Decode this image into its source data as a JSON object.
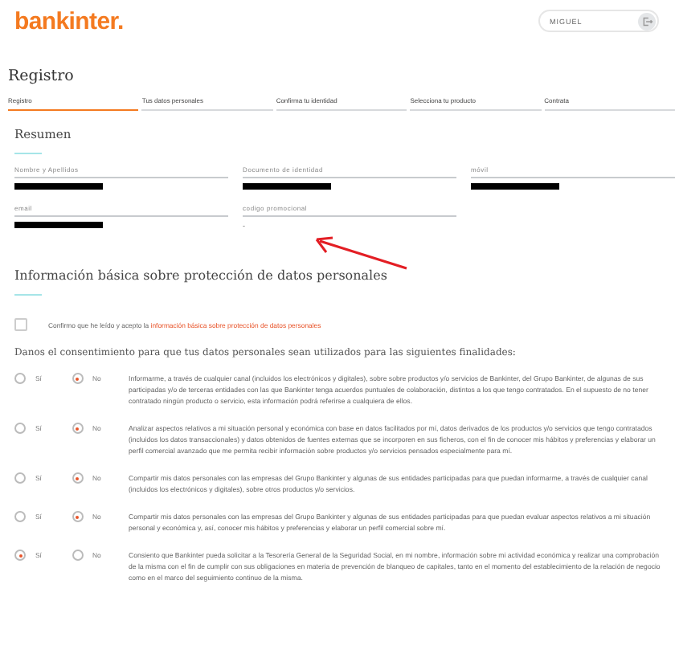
{
  "header": {
    "logo": "bankinter.",
    "user": "MIGUEL"
  },
  "page_title": "Registro",
  "steps": [
    {
      "label": "Registro",
      "selected": true
    },
    {
      "label": "Tus datos personales",
      "selected": false
    },
    {
      "label": "Confirma tu identidad",
      "selected": false
    },
    {
      "label": "Selecciona tu producto",
      "selected": false
    },
    {
      "label": "Contrata",
      "selected": false
    }
  ],
  "summary": {
    "title": "Resumen",
    "fields": [
      {
        "label": "Nombre y Apellidos",
        "redacted": true
      },
      {
        "label": "Documento de identidad",
        "redacted": true
      },
      {
        "label": "móvil",
        "redacted": true
      },
      {
        "label": "email",
        "redacted": true
      },
      {
        "label": "codigo promocional",
        "redacted": false,
        "value": "-"
      }
    ]
  },
  "privacy": {
    "title": "Información básica sobre protección de datos personales",
    "confirm": {
      "checked": false,
      "text": "Confirmo que he leído y acepto la ",
      "link": "información básica sobre protección de datos personales"
    },
    "consent_heading": "Danos el consentimiento para que tus datos personales sean utilizados para las siguientes finalidades:",
    "consents": [
      {
        "options": [
          {
            "label": "Sí",
            "selected": false
          },
          {
            "label": "No",
            "selected": true
          }
        ],
        "text": "Informarme, a través de cualquier canal (incluidos los electrónicos y digitales), sobre sobre productos y/o servicios de Bankinter, del Grupo Bankinter, de algunas de sus participadas y/o de terceras entidades con las que Bankinter tenga acuerdos puntuales de colaboración, distintos a los que tengo contratados. En el supuesto de no tener contratado ningún producto o servicio, esta información podrá referirse a cualquiera de ellos."
      },
      {
        "options": [
          {
            "label": "Sí",
            "selected": false
          },
          {
            "label": "No",
            "selected": true
          }
        ],
        "text": "Analizar aspectos relativos a mi situación personal y económica con base en datos facilitados por mí, datos derivados de los productos y/o servicios que tengo contratados (incluidos los datos transaccionales) y datos obtenidos de fuentes externas que se incorporen en sus ficheros, con el fin de conocer mis hábitos y preferencias y elaborar un perfil comercial avanzado que me permita recibir información sobre productos y/o servicios pensados especialmente para mí."
      },
      {
        "options": [
          {
            "label": "Sí",
            "selected": false
          },
          {
            "label": "No",
            "selected": true
          }
        ],
        "text": "Compartir mis datos personales con las empresas del Grupo Bankinter y algunas de sus entidades participadas para que puedan informarme, a través de cualquier canal (incluidos los electrónicos y digitales), sobre otros productos y/o servicios."
      },
      {
        "options": [
          {
            "label": "Sí",
            "selected": false
          },
          {
            "label": "No",
            "selected": true
          }
        ],
        "text": "Compartir mis datos personales con las empresas del Grupo Bankinter y algunas de sus entidades participadas para que puedan evaluar aspectos relativos a mi situación personal y económica y, así, conocer mis hábitos y preferencias y elaborar un perfil comercial sobre mí."
      },
      {
        "options": [
          {
            "label": "Sí",
            "selected": true
          },
          {
            "label": "No",
            "selected": false
          }
        ],
        "text": "Consiento que Bankinter pueda solicitar a la Tesorería General de la Seguridad Social, en mi nombre, información sobre mi actividad económica y realizar una comprobación de la misma con el fin de cumplir con sus obligaciones en materia de prevención de blanqueo de capitales, tanto en el momento del establecimiento de la relación de negocio como en el marco del seguimiento continuo de la misma."
      }
    ]
  }
}
